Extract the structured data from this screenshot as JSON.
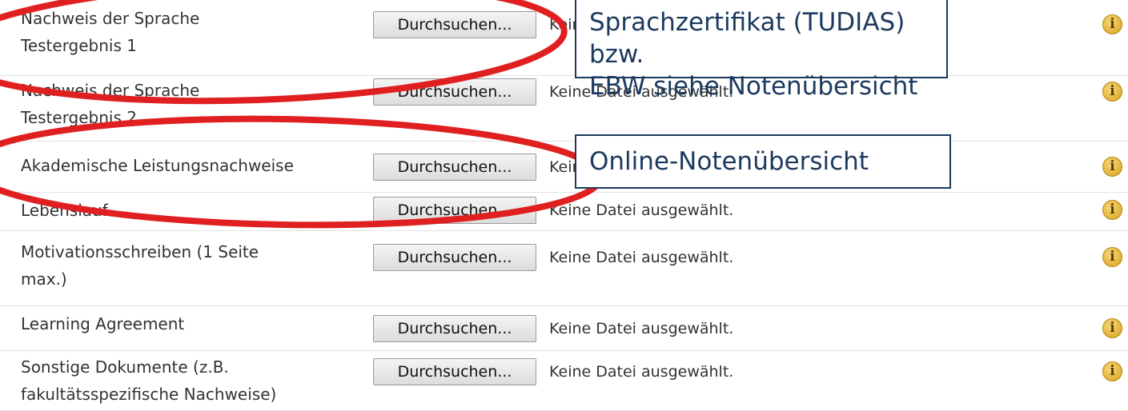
{
  "button_label": "Durchsuchen...",
  "status_text": "Keine Datei ausgewählt.",
  "info_icon_glyph": "i",
  "accent_colors": {
    "annotation_ellipse": "#e02020",
    "callout_border": "#1c3a5e",
    "info_icon": "#e0a820"
  },
  "rows": [
    {
      "label_line1": "Nachweis der Sprache",
      "label_line2": "Testergebnis 1"
    },
    {
      "label_line1": "Nachweis der Sprache",
      "label_line2": "Testergebnis 2"
    },
    {
      "label_line1": "Akademische Leistungsnachweise",
      "label_line2": ""
    },
    {
      "label_line1": "Lebenslauf",
      "label_line2": ""
    },
    {
      "label_line1": "Motivationsschreiben (1 Seite",
      "label_line2": "max.)"
    },
    {
      "label_line1": "Learning Agreement",
      "label_line2": ""
    },
    {
      "label_line1": "Sonstige Dokumente (z.B.",
      "label_line2": "fakultätsspezifische Nachweise)"
    }
  ],
  "callouts": {
    "sprachzertifikat_line1": "Sprachzertifikat (TUDIAS) bzw.",
    "sprachzertifikat_line2": "EBW siehe Notenübersicht",
    "online": "Online-Notenübersicht"
  }
}
